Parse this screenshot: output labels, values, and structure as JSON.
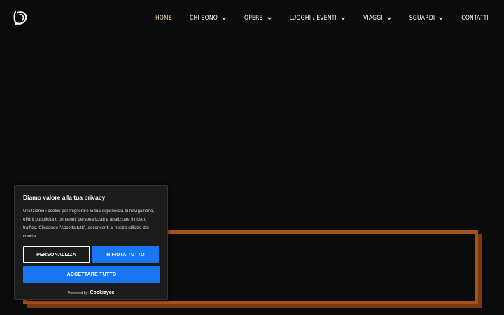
{
  "header": {
    "logo_icon": "monogram-logo-icon",
    "nav": [
      {
        "label": "HOME",
        "active": true,
        "dropdown": false
      },
      {
        "label": "CHI SONO",
        "active": false,
        "dropdown": true
      },
      {
        "label": "OPERE",
        "active": false,
        "dropdown": true
      },
      {
        "label": "LUOGHI / EVENTI",
        "active": false,
        "dropdown": true
      },
      {
        "label": "VIAGGI",
        "active": false,
        "dropdown": true
      },
      {
        "label": "SGUARDI",
        "active": false,
        "dropdown": true
      },
      {
        "label": "CONTATTI",
        "active": false,
        "dropdown": false
      }
    ]
  },
  "cookie": {
    "title": "Diamo valore alla tua privacy",
    "text": "Utilizziamo i cookie per migliorare la tua esperienza di navigazione, offrirti pubblicità o contenuti personalizzati e analizzare il nostro traffico. Cliccando \"Accetta tutti\", acconsenti al nostro utilizzo dei cookie.",
    "customize_label": "PERSONALIZZA",
    "reject_label": "RIFIUTA TUTTO",
    "accept_label": "ACCETTARE TUTTO",
    "powered_by": "Powered by",
    "powered_brand": "Cookieyes"
  },
  "colors": {
    "background": "#0b0b0b",
    "nav_active": "#e6cfa3",
    "frame_border": "#a4521a",
    "button_blue": "#1976f2"
  }
}
